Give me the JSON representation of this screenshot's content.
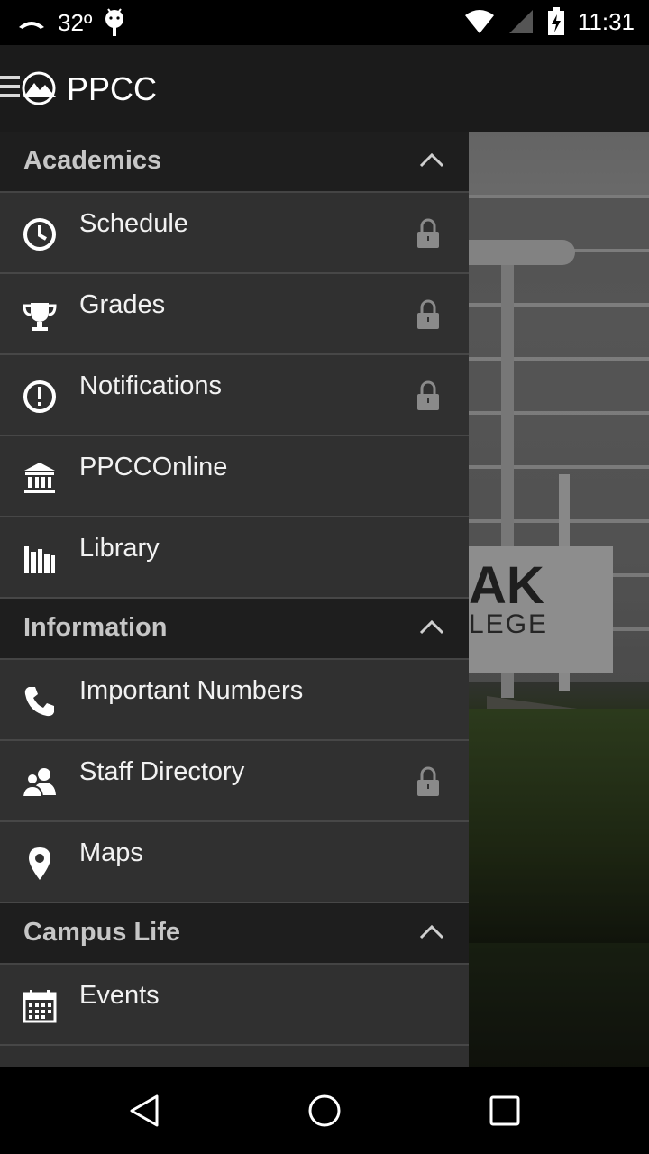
{
  "status_bar": {
    "temperature": "32º",
    "time": "11:31",
    "left_icons": [
      "weather-icon",
      "android-debug-icon"
    ],
    "right_icons": [
      "wifi-icon",
      "cell-signal-icon",
      "battery-charging-icon"
    ]
  },
  "app_bar": {
    "title": "PPCC",
    "menu_icon": "hamburger-icon",
    "logo_icon": "ppcc-mountain-logo"
  },
  "background": {
    "sign_line1": "AK",
    "sign_line2": "LEGE"
  },
  "drawer": {
    "sections": [
      {
        "title": "Academics",
        "expanded": true,
        "items": [
          {
            "label": "Schedule",
            "icon": "clock-icon",
            "locked": true
          },
          {
            "label": "Grades",
            "icon": "trophy-icon",
            "locked": true
          },
          {
            "label": "Notifications",
            "icon": "alert-circle-icon",
            "locked": true
          },
          {
            "label": "PPCCOnline",
            "icon": "institution-icon",
            "locked": false
          },
          {
            "label": "Library",
            "icon": "books-icon",
            "locked": false
          }
        ]
      },
      {
        "title": "Information",
        "expanded": true,
        "items": [
          {
            "label": "Important Numbers",
            "icon": "phone-icon",
            "locked": false
          },
          {
            "label": "Staff Directory",
            "icon": "people-icon",
            "locked": true
          },
          {
            "label": "Maps",
            "icon": "map-pin-icon",
            "locked": false
          }
        ]
      },
      {
        "title": "Campus Life",
        "expanded": true,
        "items": [
          {
            "label": "Events",
            "icon": "calendar-icon",
            "locked": false
          }
        ]
      }
    ]
  },
  "nav_bar": {
    "buttons": [
      "back-icon",
      "home-icon",
      "recents-icon"
    ]
  },
  "colors": {
    "drawer_bg": "#303030",
    "section_header_bg": "#1e1e1e",
    "app_bar_bg": "#1b1b1b",
    "lock_color": "#8a8a8a"
  }
}
